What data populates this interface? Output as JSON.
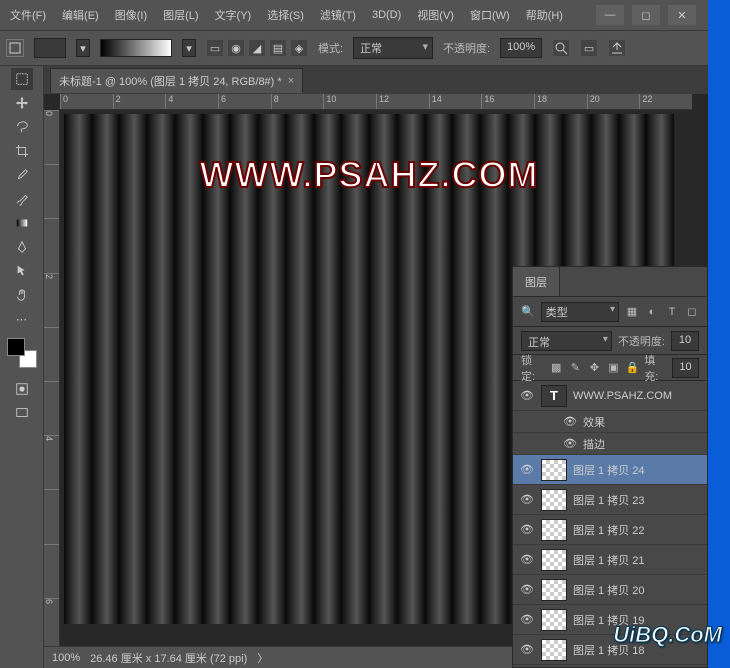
{
  "menu": {
    "file": "文件(F)",
    "edit": "编辑(E)",
    "image": "图像(I)",
    "layer": "图层(L)",
    "text": "文字(Y)",
    "select": "选择(S)",
    "filter": "滤镜(T)",
    "threeD": "3D(D)",
    "view": "视图(V)",
    "window": "窗口(W)",
    "help": "帮助(H)"
  },
  "optionbar": {
    "mode_label": "模式:",
    "mode_value": "正常",
    "opacity_label": "不透明度:",
    "opacity_value": "100%"
  },
  "doc_tab": {
    "title": "未标题-1 @ 100% (图层 1 拷贝 24, RGB/8#) *"
  },
  "hruler_ticks": [
    "0",
    "2",
    "4",
    "6",
    "8",
    "10",
    "12",
    "14",
    "16",
    "18",
    "20",
    "22"
  ],
  "vruler_ticks": [
    "0",
    "",
    "",
    "2",
    "",
    "",
    "4",
    "",
    "",
    "6"
  ],
  "watermark": "WWW.PSAHZ.COM",
  "status": {
    "zoom": "100%",
    "dims": "26.46 厘米 x 17.64 厘米 (72 ppi)",
    "arrow": "〉"
  },
  "panel": {
    "tab_layers": "图层",
    "filter_type": "类型",
    "blend_mode": "正常",
    "opacity_label": "不透明度:",
    "opacity_value": "10",
    "lock_label": "锁定:",
    "fill_label": "填充:",
    "fill_value": "10",
    "text_layer": "WWW.PSAHZ.COM",
    "fx_label": "效果",
    "stroke_label": "描边",
    "layers": [
      {
        "name": "图层 1 拷贝 24",
        "sel": true
      },
      {
        "name": "图层 1 拷贝 23"
      },
      {
        "name": "图层 1 拷贝 22"
      },
      {
        "name": "图层 1 拷贝 21"
      },
      {
        "name": "图层 1 拷贝 20"
      },
      {
        "name": "图层 1 拷贝 19"
      },
      {
        "name": "图层 1 拷贝 18"
      }
    ]
  },
  "brand": "UiBQ.CoM"
}
